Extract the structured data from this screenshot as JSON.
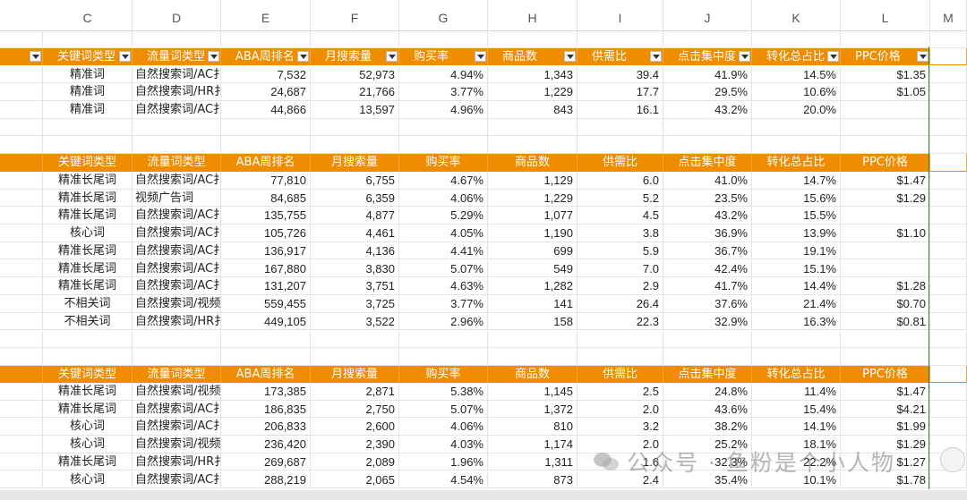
{
  "column_headers": [
    "C",
    "D",
    "E",
    "F",
    "G",
    "H",
    "I",
    "J",
    "K",
    "L",
    "M"
  ],
  "table_headers": [
    "关键词类型",
    "流量词类型",
    "ABA周排名",
    "月搜索量",
    "购买率",
    "商品数",
    "供需比",
    "点击集中度",
    "转化总占比",
    "PPC价格"
  ],
  "table1_header_visible": [
    "关键词类型",
    "流量词类型",
    "ABA周排名",
    "月搜索量",
    "购买率",
    "商品数",
    "供需比",
    "点击集中度",
    "转化总占比",
    "PPC价格"
  ],
  "tables": [
    {
      "rows": [
        [
          "精准词",
          "自然搜索词/AC扌",
          "7,532",
          "52,973",
          "4.94%",
          "1,343",
          "39.4",
          "41.9%",
          "14.5%",
          "$1.35"
        ],
        [
          "精准词",
          "自然搜索词/HR扌",
          "24,687",
          "21,766",
          "3.77%",
          "1,229",
          "17.7",
          "29.5%",
          "10.6%",
          "$1.05"
        ],
        [
          "精准词",
          "自然搜索词/AC扌",
          "44,866",
          "13,597",
          "4.96%",
          "843",
          "16.1",
          "43.2%",
          "20.0%",
          ""
        ]
      ]
    },
    {
      "rows": [
        [
          "精准长尾词",
          "自然搜索词/AC扌",
          "77,810",
          "6,755",
          "4.67%",
          "1,129",
          "6.0",
          "41.0%",
          "14.7%",
          "$1.47"
        ],
        [
          "精准长尾词",
          "视频广告词",
          "84,685",
          "6,359",
          "4.06%",
          "1,229",
          "5.2",
          "23.5%",
          "15.6%",
          "$1.29"
        ],
        [
          "精准长尾词",
          "自然搜索词/AC扌",
          "135,755",
          "4,877",
          "5.29%",
          "1,077",
          "4.5",
          "43.2%",
          "15.5%",
          ""
        ],
        [
          "核心词",
          "自然搜索词/AC扌",
          "105,726",
          "4,461",
          "4.05%",
          "1,190",
          "3.8",
          "36.9%",
          "13.9%",
          "$1.10"
        ],
        [
          "精准长尾词",
          "自然搜索词/AC扌",
          "136,917",
          "4,136",
          "4.41%",
          "699",
          "5.9",
          "36.7%",
          "19.1%",
          ""
        ],
        [
          "精准长尾词",
          "自然搜索词/AC扌",
          "167,880",
          "3,830",
          "5.07%",
          "549",
          "7.0",
          "42.4%",
          "15.1%",
          ""
        ],
        [
          "精准长尾词",
          "自然搜索词/AC扌",
          "131,207",
          "3,751",
          "4.63%",
          "1,282",
          "2.9",
          "41.7%",
          "14.4%",
          "$1.28"
        ],
        [
          "不相关词",
          "自然搜索词/视频",
          "559,455",
          "3,725",
          "3.77%",
          "141",
          "26.4",
          "37.6%",
          "21.4%",
          "$0.70"
        ],
        [
          "不相关词",
          "自然搜索词/HR扌",
          "449,105",
          "3,522",
          "2.96%",
          "158",
          "22.3",
          "32.9%",
          "16.3%",
          "$0.81"
        ]
      ]
    },
    {
      "rows": [
        [
          "精准长尾词",
          "自然搜索词/视频",
          "173,385",
          "2,871",
          "5.38%",
          "1,145",
          "2.5",
          "24.8%",
          "11.4%",
          "$1.47"
        ],
        [
          "精准长尾词",
          "自然搜索词/AC扌",
          "186,835",
          "2,750",
          "5.07%",
          "1,372",
          "2.0",
          "43.6%",
          "15.4%",
          "$4.21"
        ],
        [
          "核心词",
          "自然搜索词/AC扌",
          "206,833",
          "2,600",
          "4.06%",
          "810",
          "3.2",
          "38.2%",
          "14.1%",
          "$1.99"
        ],
        [
          "核心词",
          "自然搜索词/视频",
          "236,420",
          "2,390",
          "4.03%",
          "1,174",
          "2.0",
          "25.2%",
          "18.1%",
          "$1.29"
        ],
        [
          "精准长尾词",
          "自然搜索词/HR扌",
          "269,687",
          "2,089",
          "1.96%",
          "1,311",
          "1.6",
          "32.3%",
          "22.2%",
          "$1.27"
        ],
        [
          "核心词",
          "自然搜索词/AC扌",
          "288,219",
          "2,065",
          "4.54%",
          "873",
          "2.4",
          "35.4%",
          "10.1%",
          "$1.78"
        ]
      ]
    }
  ],
  "watermark": {
    "text": "公众号 · 鱼粉是个小人物",
    "icon": "wechat-icon"
  },
  "colors": {
    "header_orange": "#f08c00",
    "frozen_line": "#1e8e3e"
  }
}
